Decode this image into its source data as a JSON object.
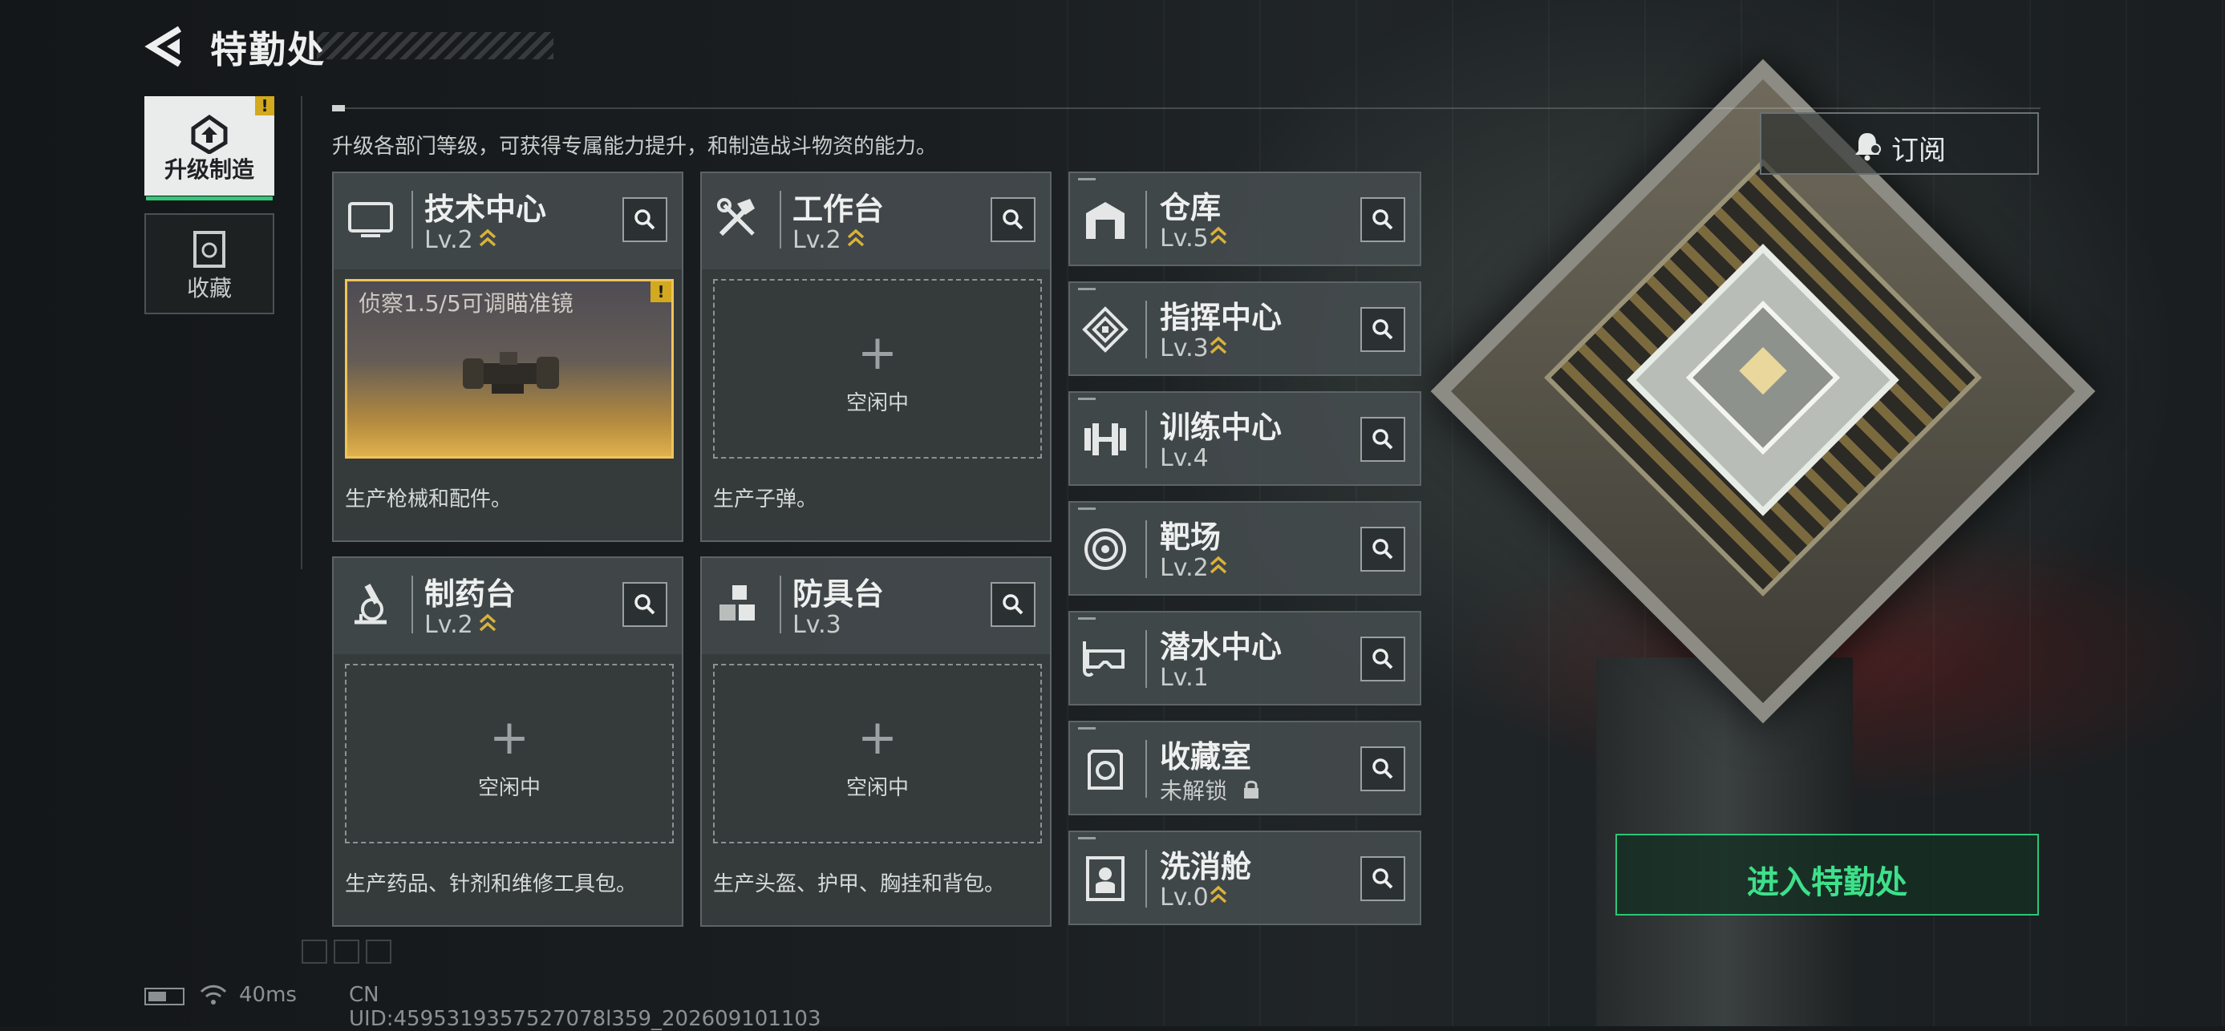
{
  "header": {
    "title": "特勤处"
  },
  "tabs": [
    {
      "label": "升级制造",
      "badge": "!"
    },
    {
      "label": "收藏"
    }
  ],
  "description": "升级各部门等级，可获得专属能力提升，和制造战斗物资的能力。",
  "subscribe_label": "订阅",
  "enter_label": "进入特勤处",
  "workshops": [
    {
      "name": "技术中心",
      "level": "Lv.2",
      "upgradable": true,
      "crafting": {
        "item": "侦察1.5/5可调瞄准镜",
        "badge": "!"
      },
      "product_desc": "生产枪械和配件。"
    },
    {
      "name": "工作台",
      "level": "Lv.2",
      "upgradable": true,
      "slot_status": "空闲中",
      "plus": "+",
      "product_desc": "生产子弹。"
    },
    {
      "name": "制药台",
      "level": "Lv.2",
      "upgradable": true,
      "slot_status": "空闲中",
      "plus": "+",
      "product_desc": "生产药品、针剂和维修工具包。"
    },
    {
      "name": "防具台",
      "level": "Lv.3",
      "upgradable": false,
      "slot_status": "空闲中",
      "plus": "+",
      "product_desc": "生产头盔、护甲、胸挂和背包。"
    }
  ],
  "facilities": [
    {
      "name": "仓库",
      "level": "Lv.5",
      "upgradable": true,
      "icon": "warehouse-icon"
    },
    {
      "name": "指挥中心",
      "level": "Lv.3",
      "upgradable": true,
      "icon": "command-center-icon"
    },
    {
      "name": "训练中心",
      "level": "Lv.4",
      "upgradable": false,
      "icon": "dumbbell-icon"
    },
    {
      "name": "靶场",
      "level": "Lv.2",
      "upgradable": true,
      "icon": "target-icon"
    },
    {
      "name": "潜水中心",
      "level": "Lv.1",
      "upgradable": false,
      "icon": "diving-mask-icon"
    },
    {
      "name": "收藏室",
      "level": "未解锁",
      "upgradable": false,
      "locked": true,
      "icon": "collection-icon"
    },
    {
      "name": "洗消舱",
      "level": "Lv.0",
      "upgradable": true,
      "icon": "decontamination-icon"
    }
  ],
  "status_bar": {
    "ping": "40ms",
    "uid": "CN UID:4595319357527078l359_202609101103"
  },
  "colors": {
    "accent_green": "#3ee08a",
    "upgrade_gold": "#d8b23a",
    "warning": "#d2a91f"
  }
}
